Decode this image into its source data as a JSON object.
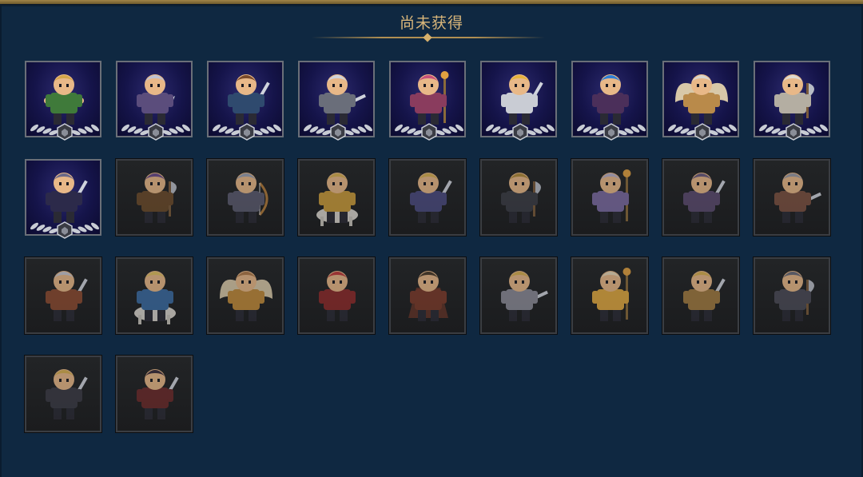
{
  "panel": {
    "title": "尚未获得"
  },
  "heroes": [
    {
      "owned": true,
      "armor": "#3f7a3a",
      "hair": "#d4a64a",
      "weapon": "fists"
    },
    {
      "owned": true,
      "armor": "#5b4d7c",
      "hair": "#bfc3d2",
      "weapon": "claw"
    },
    {
      "owned": true,
      "armor": "#2f4a6e",
      "hair": "#7a4a2a",
      "weapon": "sword"
    },
    {
      "owned": true,
      "armor": "#6a6e7a",
      "hair": "#d0d4dc",
      "weapon": "blade"
    },
    {
      "owned": true,
      "armor": "#8a3c5e",
      "hair": "#c8507a",
      "weapon": "staff"
    },
    {
      "owned": true,
      "armor": "#c9ccd4",
      "hair": "#e6b33c",
      "weapon": "sword"
    },
    {
      "owned": true,
      "armor": "#4b2f5a",
      "hair": "#2f7fd6",
      "weapon": "none"
    },
    {
      "owned": true,
      "armor": "#b98a4a",
      "hair": "#d8d6cf",
      "weapon": "wings"
    },
    {
      "owned": true,
      "armor": "#b4aea2",
      "hair": "#dedad2",
      "weapon": "axe"
    },
    {
      "owned": true,
      "armor": "#2c2a4a",
      "hair": "#6c6a88",
      "weapon": "sword"
    },
    {
      "owned": false,
      "armor": "#6a4a2a",
      "hair": "#6a4a8a",
      "weapon": "axe"
    },
    {
      "owned": false,
      "armor": "#5a5a6e",
      "hair": "#9aa0b0",
      "weapon": "bow"
    },
    {
      "owned": false,
      "armor": "#c89a3a",
      "hair": "#d8b050",
      "weapon": "mount"
    },
    {
      "owned": false,
      "armor": "#4a4a7e",
      "hair": "#d8b050",
      "weapon": "sword"
    },
    {
      "owned": false,
      "armor": "#3a3c44",
      "hair": "#b08a3a",
      "weapon": "axe"
    },
    {
      "owned": false,
      "armor": "#7a6aa0",
      "hair": "#b8b0c8",
      "weapon": "staff"
    },
    {
      "owned": false,
      "armor": "#5a4a6e",
      "hair": "#6a5a7e",
      "weapon": "sword"
    },
    {
      "owned": false,
      "armor": "#7a5040",
      "hair": "#9a9aa6",
      "weapon": "blade"
    },
    {
      "owned": false,
      "armor": "#8a4a30",
      "hair": "#c8c8d0",
      "weapon": "sword"
    },
    {
      "owned": false,
      "armor": "#3a6aa0",
      "hair": "#e0c060",
      "weapon": "mount"
    },
    {
      "owned": false,
      "armor": "#c08a3a",
      "hair": "#b07a4a",
      "weapon": "wings"
    },
    {
      "owned": false,
      "armor": "#8a2a2a",
      "hair": "#c03a3a",
      "weapon": "none"
    },
    {
      "owned": false,
      "armor": "#7a3a2a",
      "hair": "#4a3a2a",
      "weapon": "cape"
    },
    {
      "owned": false,
      "armor": "#8a8a96",
      "hair": "#d8b050",
      "weapon": "blade"
    },
    {
      "owned": false,
      "armor": "#e0a840",
      "hair": "#e8d8b8",
      "weapon": "staff"
    },
    {
      "owned": false,
      "armor": "#a07a40",
      "hair": "#d8b050",
      "weapon": "sword"
    },
    {
      "owned": false,
      "armor": "#4a4a56",
      "hair": "#6a6a78",
      "weapon": "axe"
    },
    {
      "owned": false,
      "armor": "#3a3a44",
      "hair": "#d8b050",
      "weapon": "sword"
    },
    {
      "owned": false,
      "armor": "#6a2a2a",
      "hair": "#3a2a3a",
      "weapon": "sword"
    }
  ]
}
